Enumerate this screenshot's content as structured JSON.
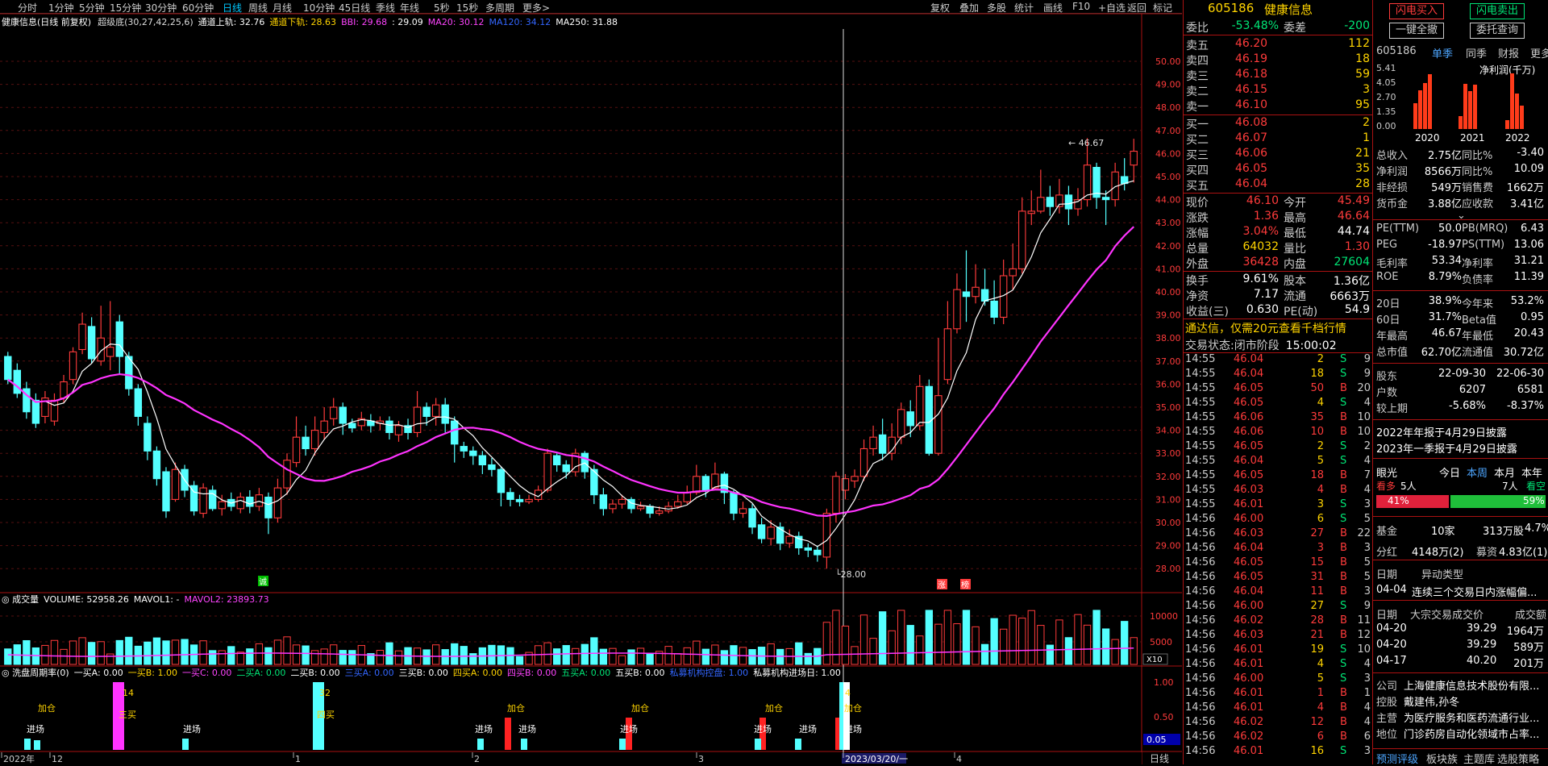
{
  "toolbar": {
    "periods": [
      "分时",
      "1分钟",
      "5分钟",
      "15分钟",
      "30分钟",
      "60分钟",
      "日线",
      "周线",
      "月线",
      "10分钟",
      "45日线",
      "季线",
      "年线",
      "5秒",
      "15秒",
      "多周期",
      "更多>"
    ],
    "active_period": "日线",
    "right": [
      "复权",
      "叠加",
      "多股",
      "统计",
      "画线",
      "F10",
      "+自选",
      "返回"
    ],
    "extra": "标记"
  },
  "main_chart": {
    "title": "健康信息(日线 前复权)",
    "indicator": "超级底(30,27,42,25,6)",
    "legend": [
      {
        "label": "通道上轨: 32.76",
        "color": "#ffffff"
      },
      {
        "label": "通道下轨: 28.63",
        "color": "#ffd400"
      },
      {
        "label": "BBI: 29.68",
        "color": "#ff44ff"
      },
      {
        "label": ": 29.09",
        "color": "#ffffff"
      },
      {
        "label": "MA20: 30.12",
        "color": "#ff44ff"
      },
      {
        "label": "MA120: 34.12",
        "color": "#3366ff"
      },
      {
        "label": "MA250: 31.88",
        "color": "#ffffff"
      }
    ],
    "price_axis": [
      "50.00",
      "49.00",
      "48.00",
      "47.00",
      "46.00",
      "45.00",
      "44.00",
      "43.00",
      "42.00",
      "41.00",
      "40.00",
      "39.00",
      "38.00",
      "37.00",
      "36.00",
      "35.00",
      "34.00",
      "33.00",
      "32.00",
      "31.00",
      "30.00",
      "29.00",
      "28.00"
    ],
    "high_label": "46.67",
    "low_label": "28.00",
    "marks": [
      "诚",
      "涨",
      "榜"
    ]
  },
  "volume_chart": {
    "title": "成交量",
    "legend": [
      {
        "label": "VOLUME: 52958.26",
        "color": "#ffffff"
      },
      {
        "label": "MAVOL1: -",
        "color": "#ffffff"
      },
      {
        "label": "MAVOL2: 23893.73",
        "color": "#ff44ff"
      }
    ],
    "axis": [
      "10000",
      "5000"
    ],
    "unit": "X10"
  },
  "signal_chart": {
    "title": "洗盘周期率(0)",
    "legend": [
      {
        "label": "一买A: 0.00",
        "color": "#ffffff"
      },
      {
        "label": "一买B: 1.00",
        "color": "#ffd400"
      },
      {
        "label": "一买C: 0.00",
        "color": "#ff44ff"
      },
      {
        "label": "二买A: 0.00",
        "color": "#00e676"
      },
      {
        "label": "二买B: 0.00",
        "color": "#ffffff"
      },
      {
        "label": "三买A: 0.00",
        "color": "#3366ff"
      },
      {
        "label": "三买B: 0.00",
        "color": "#ffffff"
      },
      {
        "label": "四买A: 0.00",
        "color": "#ffd400"
      },
      {
        "label": "四买B: 0.00",
        "color": "#ff44ff"
      },
      {
        "label": "五买A: 0.00",
        "color": "#00e676"
      },
      {
        "label": "五买B: 0.00",
        "color": "#ffffff"
      },
      {
        "label": "私募机构控盘: 1.00",
        "color": "#3366ff"
      },
      {
        "label": "私募机构进场日: 1.00",
        "color": "#ffffff"
      }
    ],
    "axis": [
      "1.00",
      "0.50"
    ],
    "corner_value": "0.05",
    "signal_labels": [
      "加仓",
      "进场",
      "三买",
      "进场",
      "四买",
      "进场",
      "加仓",
      "进场",
      "加仓",
      "进场",
      "加仓",
      "进场",
      "进场",
      "加仓",
      "进场"
    ],
    "tags": [
      "14",
      "32",
      "4"
    ]
  },
  "date_axis": {
    "labels": [
      "2022年",
      "12",
      "1",
      "2",
      "3",
      "2023/03/20/一",
      "4"
    ],
    "period": "日线"
  },
  "quote": {
    "code": "605186",
    "name": "健康信息",
    "weibi_label": "委比",
    "weibi": "-53.48%",
    "weicha_label": "委差",
    "weicha": "-200",
    "asks": [
      {
        "label": "卖五",
        "price": "46.20",
        "vol": "112"
      },
      {
        "label": "卖四",
        "price": "46.19",
        "vol": "18"
      },
      {
        "label": "卖三",
        "price": "46.18",
        "vol": "59"
      },
      {
        "label": "卖二",
        "price": "46.15",
        "vol": "3"
      },
      {
        "label": "卖一",
        "price": "46.10",
        "vol": "95"
      }
    ],
    "bids": [
      {
        "label": "买一",
        "price": "46.08",
        "vol": "2"
      },
      {
        "label": "买二",
        "price": "46.07",
        "vol": "1"
      },
      {
        "label": "买三",
        "price": "46.06",
        "vol": "21"
      },
      {
        "label": "买四",
        "price": "46.05",
        "vol": "35"
      },
      {
        "label": "买五",
        "price": "46.04",
        "vol": "28"
      }
    ],
    "stats": [
      {
        "l1": "现价",
        "v1": "46.10",
        "c1": "#ff3b3b",
        "l2": "今开",
        "v2": "45.49",
        "c2": "#ff3b3b"
      },
      {
        "l1": "涨跌",
        "v1": "1.36",
        "c1": "#ff3b3b",
        "l2": "最高",
        "v2": "46.64",
        "c2": "#ff3b3b"
      },
      {
        "l1": "涨幅",
        "v1": "3.04%",
        "c1": "#ff3b3b",
        "l2": "最低",
        "v2": "44.74",
        "c2": "#ffffff"
      },
      {
        "l1": "总量",
        "v1": "64032",
        "c1": "#ffd400",
        "l2": "量比",
        "v2": "1.30",
        "c2": "#ff3b3b"
      },
      {
        "l1": "外盘",
        "v1": "36428",
        "c1": "#ff3b3b",
        "l2": "内盘",
        "v2": "27604",
        "c2": "#00e676"
      }
    ],
    "stats2": [
      {
        "l1": "换手",
        "v1": "9.61%",
        "l2": "股本",
        "v2": "1.36亿"
      },
      {
        "l1": "净资",
        "v1": "7.17",
        "l2": "流通",
        "v2": "6663万"
      },
      {
        "l1": "收益(三)",
        "v1": "0.630",
        "l2": "PE(动)",
        "v2": "54.9"
      }
    ],
    "ad": "通达信，仅需20元查看千档行情",
    "status_label": "交易状态:",
    "status": "闭市阶段",
    "status_time": "15:00:02",
    "ticks": [
      {
        "t": "14:55",
        "p": "46.04",
        "v": "2",
        "s": "S",
        "n": "9"
      },
      {
        "t": "14:55",
        "p": "46.04",
        "v": "18",
        "s": "S",
        "n": "9"
      },
      {
        "t": "14:55",
        "p": "46.05",
        "v": "50",
        "s": "B",
        "n": "20"
      },
      {
        "t": "14:55",
        "p": "46.05",
        "v": "4",
        "s": "S",
        "n": "4"
      },
      {
        "t": "14:55",
        "p": "46.06",
        "v": "35",
        "s": "B",
        "n": "10"
      },
      {
        "t": "14:55",
        "p": "46.06",
        "v": "10",
        "s": "B",
        "n": "10"
      },
      {
        "t": "14:55",
        "p": "46.05",
        "v": "2",
        "s": "S",
        "n": "2"
      },
      {
        "t": "14:55",
        "p": "46.04",
        "v": "5",
        "s": "S",
        "n": "4"
      },
      {
        "t": "14:55",
        "p": "46.05",
        "v": "18",
        "s": "B",
        "n": "7"
      },
      {
        "t": "14:55",
        "p": "46.03",
        "v": "4",
        "s": "B",
        "n": "4"
      },
      {
        "t": "14:55",
        "p": "46.01",
        "v": "3",
        "s": "S",
        "n": "3"
      },
      {
        "t": "14:56",
        "p": "46.00",
        "v": "6",
        "s": "S",
        "n": "5"
      },
      {
        "t": "14:56",
        "p": "46.03",
        "v": "27",
        "s": "B",
        "n": "22"
      },
      {
        "t": "14:56",
        "p": "46.04",
        "v": "3",
        "s": "B",
        "n": "3"
      },
      {
        "t": "14:56",
        "p": "46.05",
        "v": "15",
        "s": "B",
        "n": "5"
      },
      {
        "t": "14:56",
        "p": "46.05",
        "v": "31",
        "s": "B",
        "n": "5"
      },
      {
        "t": "14:56",
        "p": "46.04",
        "v": "11",
        "s": "B",
        "n": "3"
      },
      {
        "t": "14:56",
        "p": "46.00",
        "v": "27",
        "s": "S",
        "n": "9"
      },
      {
        "t": "14:56",
        "p": "46.02",
        "v": "28",
        "s": "B",
        "n": "11"
      },
      {
        "t": "14:56",
        "p": "46.03",
        "v": "21",
        "s": "B",
        "n": "12"
      },
      {
        "t": "14:56",
        "p": "46.01",
        "v": "19",
        "s": "S",
        "n": "10"
      },
      {
        "t": "14:56",
        "p": "46.01",
        "v": "4",
        "s": "S",
        "n": "4"
      },
      {
        "t": "14:56",
        "p": "46.00",
        "v": "5",
        "s": "S",
        "n": "3"
      },
      {
        "t": "14:56",
        "p": "46.01",
        "v": "1",
        "s": "B",
        "n": "1"
      },
      {
        "t": "14:56",
        "p": "46.01",
        "v": "4",
        "s": "B",
        "n": "4"
      },
      {
        "t": "14:56",
        "p": "46.02",
        "v": "12",
        "s": "B",
        "n": "4"
      },
      {
        "t": "14:56",
        "p": "46.02",
        "v": "6",
        "s": "B",
        "n": "6"
      },
      {
        "t": "14:56",
        "p": "46.01",
        "v": "16",
        "s": "S",
        "n": "3"
      }
    ]
  },
  "right_panel": {
    "buttons": [
      "闪电买入",
      "闪电卖出",
      "一键全撤",
      "委托查询"
    ],
    "code": "605186",
    "tabs": [
      "单季",
      "同季",
      "财报",
      "更多>"
    ],
    "chart_title": "净利润(千万)",
    "chart_yaxis": [
      "5.41",
      "4.05",
      "2.70",
      "1.35",
      "0.00"
    ],
    "chart_years": [
      "2020",
      "2021",
      "2022"
    ],
    "profit_chart": {
      "type": "bar",
      "categories": [
        "2020",
        "2021",
        "2022"
      ],
      "series": [
        {
          "name": "净利润(千万)",
          "values": [
            2.4,
            3.6,
            4.3,
            5.1,
            1.2,
            4.2,
            3.5,
            4.1,
            0.8,
            5.2,
            3.3,
            2.2
          ]
        }
      ],
      "ylim": [
        0,
        5.41
      ]
    },
    "fin": [
      {
        "l1": "总收入",
        "v1": "2.75亿",
        "l2": "同比%",
        "v2": "-3.40"
      },
      {
        "l1": "净利润",
        "v1": "8566万",
        "l2": "同比%",
        "v2": "10.09"
      },
      {
        "l1": "非经损",
        "v1": "549万",
        "l2": "销售费",
        "v2": "1662万"
      },
      {
        "l1": "货币金",
        "v1": "3.88亿",
        "l2": "应收款",
        "v2": "3.41亿"
      }
    ],
    "ratios": [
      {
        "l1": "PE(TTM)",
        "v1": "50.0",
        "l2": "PB(MRQ)",
        "v2": "6.43"
      },
      {
        "l1": "PEG",
        "v1": "-18.97",
        "l2": "PS(TTM)",
        "v2": "13.06"
      },
      {
        "l1": "毛利率",
        "v1": "53.34",
        "l2": "净利率",
        "v2": "31.21"
      },
      {
        "l1": "ROE",
        "v1": "8.79%",
        "l2": "负债率",
        "v2": "11.39"
      }
    ],
    "perf": [
      {
        "l1": "20日",
        "v1": "38.9%",
        "l2": "今年来",
        "v2": "53.2%"
      },
      {
        "l1": "60日",
        "v1": "31.7%",
        "l2": "Beta值",
        "v2": "0.95"
      },
      {
        "l1": "年最高",
        "v1": "46.67",
        "l2": "年最低",
        "v2": "20.43"
      },
      {
        "l1": "总市值",
        "v1": "62.70亿",
        "l2": "流通值",
        "v2": "30.72亿"
      }
    ],
    "holders": [
      {
        "l": "股东",
        "a": "22-09-30",
        "b": "22-06-30"
      },
      {
        "l": "户数",
        "a": "6207",
        "b": "6581"
      },
      {
        "l": "较上期",
        "a": "-5.68%",
        "b": "-8.37%"
      }
    ],
    "reports": [
      "2022年年报于4月29日披露",
      "2023年一季报于4月29日披露"
    ],
    "eye": {
      "label": "眼光",
      "tabs": [
        "今日",
        "本周",
        "本月",
        "本年"
      ],
      "active": "本周",
      "bull": "看多",
      "count": "5人",
      "count2": "7人",
      "bear": "看空",
      "bull_pct": "41%",
      "bear_pct": "59%"
    },
    "fund": {
      "label": "基金",
      "a": "10家",
      "b": "313万股",
      "c": "4.7%"
    },
    "dividend": {
      "label": "分红",
      "a": "4148万(2)",
      "b": "募资",
      "c": "4.83亿(1)"
    },
    "alert_header": {
      "a": "日期",
      "b": "异动类型"
    },
    "alert": {
      "date": "04-04",
      "text": "连续三个交易日内涨幅偏..."
    },
    "block_header": {
      "a": "日期",
      "b": "大宗交易成交价",
      "c": "成交额"
    },
    "blocks": [
      {
        "d": "04-20",
        "p": "39.29",
        "a": "1964万"
      },
      {
        "d": "04-20",
        "p": "39.29",
        "a": "589万"
      },
      {
        "d": "04-17",
        "p": "40.20",
        "a": "201万"
      }
    ],
    "company": [
      {
        "l": "公司",
        "v": "上海健康信息技术股份有限..."
      },
      {
        "l": "控股",
        "v": "戴建伟,孙冬"
      },
      {
        "l": "主营",
        "v": "为医疗服务和医药流通行业..."
      },
      {
        "l": "地位",
        "v": "门诊药房自动化领域市占率..."
      }
    ],
    "bottom": [
      "预测评级",
      "板块族",
      "主题库",
      "选股策略"
    ]
  }
}
